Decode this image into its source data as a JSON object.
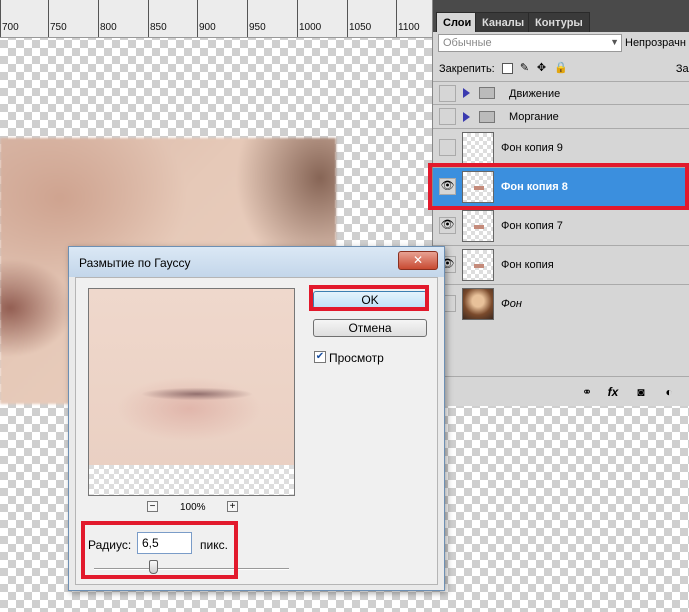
{
  "ruler": {
    "ticks": [
      "700",
      "750",
      "800",
      "850",
      "900",
      "950",
      "1000",
      "1050",
      "1100"
    ]
  },
  "layers_panel": {
    "tabs": [
      "Слои",
      "Каналы",
      "Контуры"
    ],
    "blend_mode": "Обычные",
    "opacity_label": "Непрозрачн",
    "lock_label": "Закрепить:",
    "fill_label": "Зал",
    "layers": [
      {
        "name": "Движение",
        "type": "group"
      },
      {
        "name": "Моргание",
        "type": "group"
      },
      {
        "name": "Фон копия 9",
        "type": "layer",
        "visible": false,
        "selected": false
      },
      {
        "name": "Фон копия 8",
        "type": "layer",
        "visible": true,
        "selected": true
      },
      {
        "name": "Фон копия 7",
        "type": "layer",
        "visible": true,
        "selected": false
      },
      {
        "name": "Фон копия",
        "type": "layer",
        "visible": true,
        "selected": false
      },
      {
        "name": "Фон",
        "type": "layer",
        "visible": false,
        "selected": false
      }
    ],
    "footer_icons": [
      "link-icon",
      "fx-icon",
      "mask-icon",
      "adjustment-icon"
    ]
  },
  "dialog": {
    "title": "Размытие по Гауссу",
    "close": "✕",
    "ok_label": "OK",
    "cancel_label": "Отмена",
    "preview_label": "Просмотр",
    "preview_checked": true,
    "zoom_minus": "−",
    "zoom_plus": "+",
    "zoom_level": "100%",
    "radius_label": "Радиус:",
    "radius_value": "6,5",
    "radius_unit": "пикс.",
    "slider_position": 0.31
  },
  "colors": {
    "highlight": "#e2192c",
    "selection": "#3b8fde"
  }
}
